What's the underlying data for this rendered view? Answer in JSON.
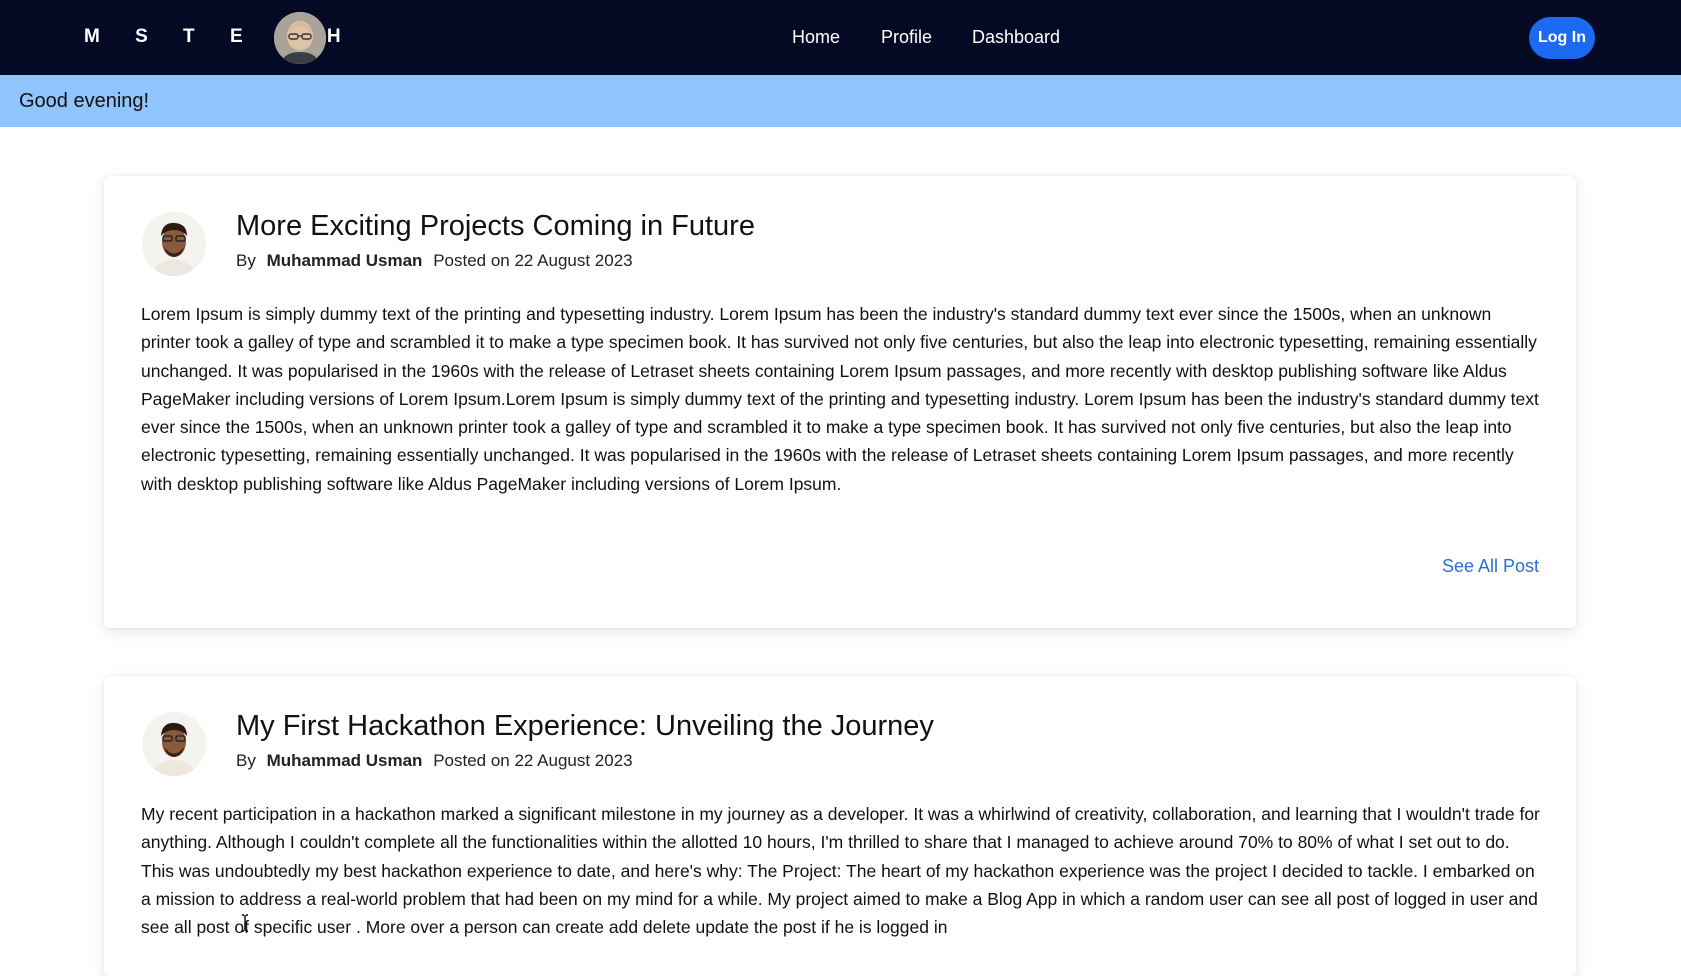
{
  "nav": {
    "brand": "M S T E C H",
    "links": [
      "Home",
      "Profile",
      "Dashboard"
    ],
    "login_label": "Log In",
    "colors": {
      "background": "#050a24",
      "login": "#1a6bf0"
    }
  },
  "greeting": {
    "text": "Good evening!",
    "color": "#90c4fc"
  },
  "posts": [
    {
      "title": "More Exciting Projects Coming in Future",
      "by_label": "By",
      "author": "Muhammad Usman",
      "posted": "Posted on 22 August 2023",
      "body": "Lorem Ipsum is simply dummy text of the printing and typesetting industry. Lorem Ipsum has been the industry's standard dummy text ever since the 1500s, when an unknown printer took a galley of type and scrambled it to make a type specimen book. It has survived not only five centuries, but also the leap into electronic typesetting, remaining essentially unchanged. It was popularised in the 1960s with the release of Letraset sheets containing Lorem Ipsum passages, and more recently with desktop publishing software like Aldus PageMaker including versions of Lorem Ipsum.Lorem Ipsum is simply dummy text of the printing and typesetting industry. Lorem Ipsum has been the industry's standard dummy text ever since the 1500s, when an unknown printer took a galley of type and scrambled it to make a type specimen book. It has survived not only five centuries, but also the leap into electronic typesetting, remaining essentially unchanged. It was popularised in the 1960s with the release of Letraset sheets containing Lorem Ipsum passages, and more recently with desktop publishing software like Aldus PageMaker including versions of Lorem Ipsum.",
      "link_label": "See All Post"
    },
    {
      "title": "My First Hackathon Experience: Unveiling the Journey",
      "by_label": "By",
      "author": "Muhammad Usman",
      "posted": "Posted on 22 August 2023",
      "body": "My recent participation in a hackathon marked a significant milestone in my journey as a developer. It was a whirlwind of creativity, collaboration, and learning that I wouldn't trade for anything. Although I couldn't complete all the functionalities within the allotted 10 hours, I'm thrilled to share that I managed to achieve around 70% to 80% of what I set out to do. This was undoubtedly my best hackathon experience to date, and here's why: The Project: The heart of my hackathon experience was the project I decided to tackle. I embarked on a mission to address a real-world problem that had been on my mind for a while. My project aimed to make a Blog App in which a random user can see all post of logged in user and see all post of specific user . More over a person can create add delete update the post if he is logged in"
    }
  ]
}
